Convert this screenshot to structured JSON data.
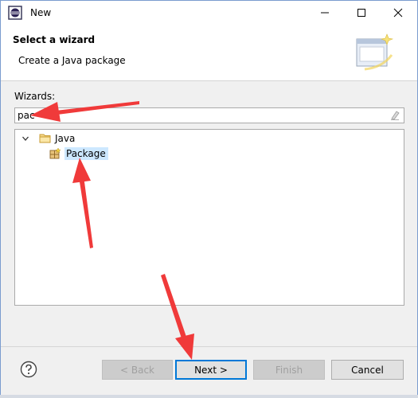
{
  "window": {
    "title": "New"
  },
  "header": {
    "title": "Select a wizard",
    "subtitle": "Create a Java package"
  },
  "wizards": {
    "label": "Wizards:",
    "filter_value": "pac"
  },
  "tree": {
    "items": [
      {
        "label": "Java",
        "expanded": true,
        "icon": "folder-icon"
      },
      {
        "label": "Package",
        "selected": true,
        "icon": "package-icon"
      }
    ]
  },
  "buttons": {
    "back": "< Back",
    "next": "Next >",
    "finish": "Finish",
    "cancel": "Cancel"
  },
  "colors": {
    "annotation_arrow": "#f03a3a",
    "selection": "#cde8ff",
    "default_button_border": "#0078d7"
  }
}
